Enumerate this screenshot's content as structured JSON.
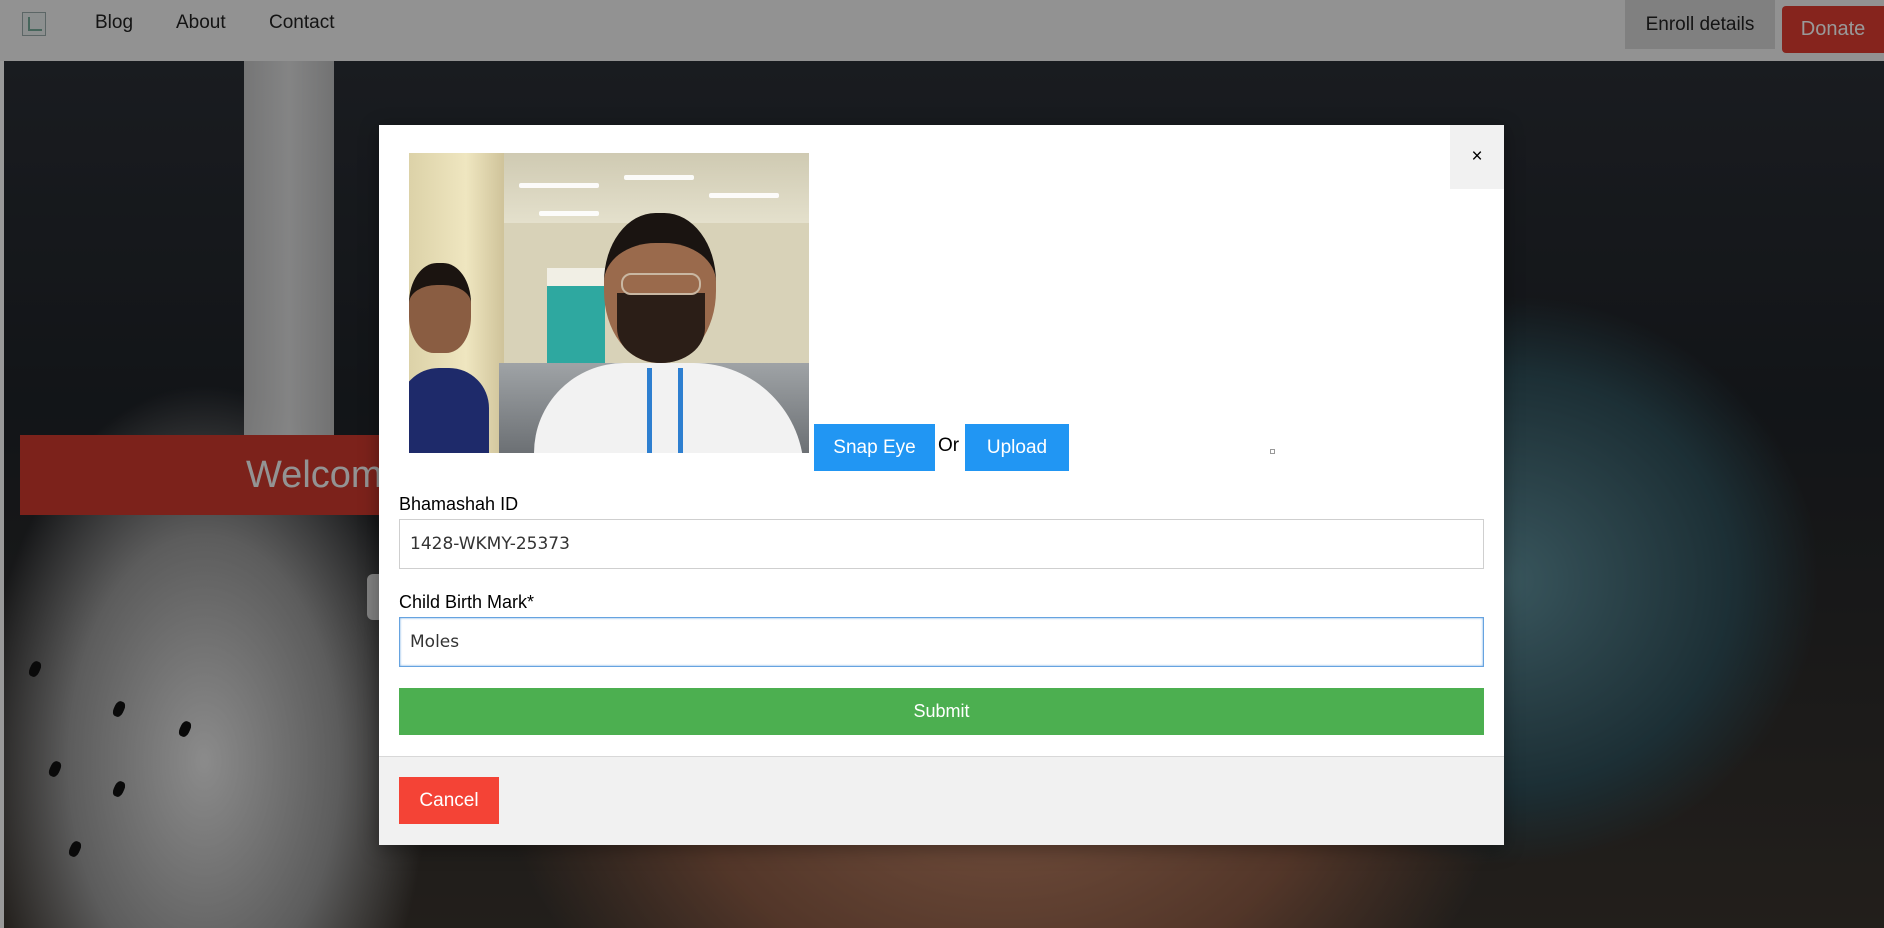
{
  "navbar": {
    "links": [
      "Blog",
      "About",
      "Contact"
    ],
    "enroll_label": "Enroll details",
    "donate_label": "Donate"
  },
  "hero": {
    "welcome_text": "Welcome"
  },
  "modal": {
    "close_label": "×",
    "snap_label": "Snap Eye",
    "or_text": "Or",
    "upload_label": "Upload",
    "bhamashah_label": "Bhamashah ID",
    "bhamashah_value": "1428-WKMY-25373",
    "birthmark_label": "Child Birth Mark*",
    "birthmark_value": "Moles",
    "submit_label": "Submit",
    "cancel_label": "Cancel"
  },
  "colors": {
    "primary_blue": "#2196f3",
    "submit_green": "#4caf50",
    "cancel_red": "#f44336",
    "donate_red": "#e03c31"
  }
}
